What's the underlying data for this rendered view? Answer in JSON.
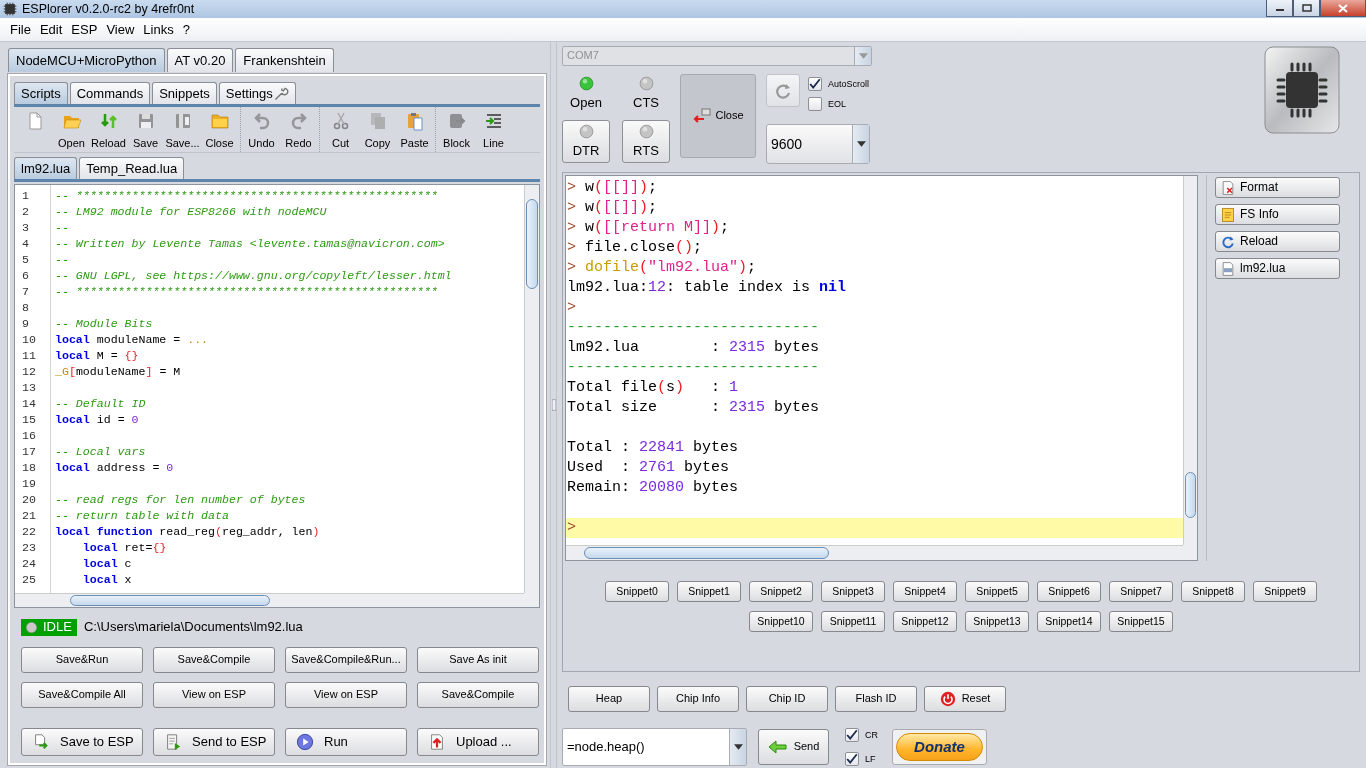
{
  "window": {
    "title": "ESPlorer v0.2.0-rc2 by 4refr0nt"
  },
  "menu": [
    "File",
    "Edit",
    "ESP",
    "View",
    "Links",
    "?"
  ],
  "device_tabs": [
    {
      "label": "NodeMCU+MicroPython",
      "selected": true
    },
    {
      "label": "AT v0.20",
      "selected": false
    },
    {
      "label": "Frankenshtein",
      "selected": false
    }
  ],
  "section_tabs": [
    {
      "label": "Scripts",
      "selected": true
    },
    {
      "label": "Commands",
      "selected": false
    },
    {
      "label": "Snippets",
      "selected": false
    },
    {
      "label": "Settings",
      "selected": false,
      "kind": "settings"
    }
  ],
  "toolbar": [
    [
      {
        "disabled": false
      },
      {
        "label": "Open",
        "disabled": false
      },
      {
        "label": "Reload",
        "disabled": false
      },
      {
        "label": "Save",
        "disabled": true
      },
      {
        "label": "Save...",
        "disabled": true
      },
      {
        "label": "Close",
        "disabled": false
      }
    ],
    [
      {
        "label": "Undo",
        "disabled": true
      },
      {
        "label": "Redo",
        "disabled": true
      }
    ],
    [
      {
        "label": "Cut",
        "disabled": true
      },
      {
        "label": "Copy",
        "disabled": true
      },
      {
        "label": "Paste",
        "disabled": false
      }
    ],
    [
      {
        "label": "Block",
        "disabled": true
      },
      {
        "label": "Line",
        "disabled": false
      }
    ]
  ],
  "file_tabs": [
    {
      "label": "lm92.lua",
      "selected": true
    },
    {
      "label": "Temp_Read.lua",
      "selected": false
    }
  ],
  "editor": {
    "lines": [
      {
        "number": "1",
        "segments": [
          {
            "kind": "comment",
            "text": "-- ****************************************************"
          }
        ]
      },
      {
        "number": "2",
        "segments": [
          {
            "kind": "comment",
            "text": "-- LM92 module for ESP8266 with nodeMCU"
          }
        ]
      },
      {
        "number": "3",
        "segments": [
          {
            "kind": "comment",
            "text": "--"
          }
        ]
      },
      {
        "number": "4",
        "segments": [
          {
            "kind": "comment",
            "text": "-- Written by Levente Tamas <levente.tamas@navicron.com>"
          }
        ]
      },
      {
        "number": "5",
        "segments": [
          {
            "kind": "comment",
            "text": "--"
          }
        ]
      },
      {
        "number": "6",
        "segments": [
          {
            "kind": "comment",
            "text": "-- GNU LGPL, see https://www.gnu.org/copyleft/lesser.html"
          }
        ]
      },
      {
        "number": "7",
        "segments": [
          {
            "kind": "comment",
            "text": "-- ****************************************************"
          }
        ]
      },
      {
        "number": "8"
      },
      {
        "number": "9",
        "segments": [
          {
            "kind": "comment",
            "text": "-- Module Bits"
          }
        ]
      },
      {
        "number": "10",
        "segments": [
          {
            "kind": "keyword",
            "text": "local"
          },
          {
            "kind": "plain",
            "text": " moduleName = "
          },
          {
            "kind": "global",
            "text": "..."
          }
        ]
      },
      {
        "number": "11",
        "segments": [
          {
            "kind": "keyword",
            "text": "local"
          },
          {
            "kind": "plain",
            "text": " M = "
          },
          {
            "kind": "bracket",
            "text": "{}"
          }
        ]
      },
      {
        "number": "12",
        "segments": [
          {
            "kind": "global",
            "text": "_G"
          },
          {
            "kind": "bracket",
            "text": "["
          },
          {
            "kind": "plain",
            "text": "moduleName"
          },
          {
            "kind": "bracket",
            "text": "]"
          },
          {
            "kind": "plain",
            "text": " = M"
          }
        ]
      },
      {
        "number": "13"
      },
      {
        "number": "14",
        "segments": [
          {
            "kind": "comment",
            "text": "-- Default ID"
          }
        ]
      },
      {
        "number": "15",
        "segments": [
          {
            "kind": "keyword",
            "text": "local"
          },
          {
            "kind": "plain",
            "text": " id = "
          },
          {
            "kind": "number",
            "text": "0"
          }
        ]
      },
      {
        "number": "16"
      },
      {
        "number": "17",
        "segments": [
          {
            "kind": "comment",
            "text": "-- Local vars"
          }
        ]
      },
      {
        "number": "18",
        "segments": [
          {
            "kind": "keyword",
            "text": "local"
          },
          {
            "kind": "plain",
            "text": " address = "
          },
          {
            "kind": "number",
            "text": "0"
          }
        ]
      },
      {
        "number": "19"
      },
      {
        "number": "20",
        "segments": [
          {
            "kind": "comment",
            "text": "-- read regs for len number of bytes"
          }
        ]
      },
      {
        "number": "21",
        "segments": [
          {
            "kind": "comment",
            "text": "-- return table with data"
          }
        ]
      },
      {
        "number": "22",
        "segments": [
          {
            "kind": "keyword",
            "text": "local function"
          },
          {
            "kind": "plain",
            "text": " read_reg"
          },
          {
            "kind": "bracket",
            "text": "("
          },
          {
            "kind": "plain",
            "text": "reg_addr, len"
          },
          {
            "kind": "bracket",
            "text": ")"
          }
        ],
        "children": [
          {
            "number": "23",
            "segments": [
              {
                "kind": "keyword",
                "text": "local"
              },
              {
                "kind": "plain",
                "text": " ret="
              },
              {
                "kind": "bracket",
                "text": "{}"
              }
            ]
          },
          {
            "number": "24",
            "segments": [
              {
                "kind": "keyword",
                "text": "local"
              },
              {
                "kind": "plain",
                "text": " c"
              }
            ]
          },
          {
            "number": "25",
            "segments": [
              {
                "kind": "keyword",
                "text": "local"
              },
              {
                "kind": "plain",
                "text": " x"
              }
            ]
          }
        ]
      }
    ]
  },
  "status": {
    "state": "IDLE",
    "path": "C:\\Users\\mariela\\Documents\\lm92.lua"
  },
  "script_buttons": [
    "Save&Run",
    "Save&Compile",
    "Save&Compile&Run...",
    "Save As init",
    "Save&Compile All",
    "View on ESP",
    "View on ESP",
    "Save&Compile"
  ],
  "action_buttons": [
    "Save to ESP",
    "Send to ESP",
    "Run",
    "Upload ..."
  ],
  "port": {
    "value": "COM7",
    "disabled": true
  },
  "signals": [
    {
      "label": "Open",
      "on": true,
      "kind": "indicator"
    },
    {
      "label": "DTR",
      "on": false,
      "kind": "toggle"
    },
    {
      "label": "CTS",
      "on": false,
      "kind": "indicator"
    },
    {
      "label": "RTS",
      "on": false,
      "kind": "toggle"
    }
  ],
  "connect_button": {
    "label": "Close"
  },
  "options": [
    {
      "label": "AutoScroll",
      "checked": true
    },
    {
      "label": "EOL",
      "checked": false
    }
  ],
  "baud": {
    "value": "9600"
  },
  "console": {
    "lines": [
      {
        "kind": "text",
        "highlighted": false,
        "segments": [
          {
            "kind": "prompt",
            "text": ">"
          },
          {
            "kind": "plain",
            "text": " w"
          },
          {
            "kind": "bracket",
            "text": "("
          },
          {
            "kind": "string",
            "text": "[[]]"
          },
          {
            "kind": "bracket",
            "text": ")"
          },
          {
            "kind": "plain",
            "text": ";"
          }
        ]
      },
      {
        "kind": "text",
        "highlighted": false,
        "segments": [
          {
            "kind": "prompt",
            "text": ">"
          },
          {
            "kind": "plain",
            "text": " w"
          },
          {
            "kind": "bracket",
            "text": "("
          },
          {
            "kind": "string",
            "text": "[[]]"
          },
          {
            "kind": "bracket",
            "text": ")"
          },
          {
            "kind": "plain",
            "text": ";"
          }
        ]
      },
      {
        "kind": "text",
        "highlighted": false,
        "segments": [
          {
            "kind": "prompt",
            "text": ">"
          },
          {
            "kind": "plain",
            "text": " w"
          },
          {
            "kind": "bracket",
            "text": "("
          },
          {
            "kind": "string",
            "text": "[[return M]]"
          },
          {
            "kind": "bracket",
            "text": ")"
          },
          {
            "kind": "plain",
            "text": ";"
          }
        ]
      },
      {
        "kind": "text",
        "highlighted": false,
        "segments": [
          {
            "kind": "prompt",
            "text": ">"
          },
          {
            "kind": "plain",
            "text": " file.close"
          },
          {
            "kind": "bracket",
            "text": "()"
          },
          {
            "kind": "plain",
            "text": ";"
          }
        ]
      },
      {
        "kind": "text",
        "highlighted": false,
        "segments": [
          {
            "kind": "prompt",
            "text": "> "
          },
          {
            "kind": "function",
            "text": "dofile"
          },
          {
            "kind": "bracket",
            "text": "("
          },
          {
            "kind": "string",
            "text": "\"lm92.lua\""
          },
          {
            "kind": "bracket",
            "text": ")"
          },
          {
            "kind": "plain",
            "text": ";"
          }
        ]
      },
      {
        "kind": "text",
        "highlighted": false,
        "segments": [
          {
            "kind": "plain",
            "text": "lm92.lua:"
          },
          {
            "kind": "number",
            "text": "12"
          },
          {
            "kind": "plain",
            "text": ": table index is "
          },
          {
            "kind": "keyword",
            "text": "nil"
          }
        ]
      },
      {
        "kind": "text",
        "highlighted": false,
        "segments": [
          {
            "kind": "prompt",
            "text": ">"
          }
        ]
      },
      {
        "kind": "text",
        "highlighted": false,
        "segments": [
          {
            "kind": "rule",
            "text": "----------------------------"
          }
        ]
      },
      {
        "kind": "text",
        "highlighted": false,
        "segments": [
          {
            "kind": "plain",
            "text": "lm92.lua        : "
          },
          {
            "kind": "number",
            "text": "2315"
          },
          {
            "kind": "plain",
            "text": " bytes"
          }
        ]
      },
      {
        "kind": "text",
        "highlighted": false,
        "segments": [
          {
            "kind": "rule",
            "text": "----------------------------"
          }
        ]
      },
      {
        "kind": "text",
        "highlighted": false,
        "segments": [
          {
            "kind": "plain",
            "text": "Total file"
          },
          {
            "kind": "bracket",
            "text": "("
          },
          {
            "kind": "plain",
            "text": "s"
          },
          {
            "kind": "bracket",
            "text": ")"
          },
          {
            "kind": "plain",
            "text": "   : "
          },
          {
            "kind": "number",
            "text": "1"
          }
        ]
      },
      {
        "kind": "text",
        "highlighted": false,
        "segments": [
          {
            "kind": "plain",
            "text": "Total size      : "
          },
          {
            "kind": "number",
            "text": "2315"
          },
          {
            "kind": "plain",
            "text": " bytes"
          }
        ]
      },
      {
        "kind": "blank",
        "highlighted": false
      },
      {
        "kind": "text",
        "highlighted": false,
        "segments": [
          {
            "kind": "plain",
            "text": "Total : "
          },
          {
            "kind": "number",
            "text": "22841"
          },
          {
            "kind": "plain",
            "text": " bytes"
          }
        ]
      },
      {
        "kind": "text",
        "highlighted": false,
        "segments": [
          {
            "kind": "plain",
            "text": "Used  : "
          },
          {
            "kind": "number",
            "text": "2761"
          },
          {
            "kind": "plain",
            "text": " bytes"
          }
        ]
      },
      {
        "kind": "text",
        "highlighted": false,
        "segments": [
          {
            "kind": "plain",
            "text": "Remain: "
          },
          {
            "kind": "number",
            "text": "20080"
          },
          {
            "kind": "plain",
            "text": " bytes"
          }
        ]
      },
      {
        "kind": "blank",
        "highlighted": false
      },
      {
        "kind": "text",
        "highlighted": true,
        "segments": [
          {
            "kind": "prompt",
            "text": ">"
          }
        ]
      }
    ]
  },
  "file_buttons": [
    "Format",
    "FS Info",
    "Reload",
    "lm92.lua"
  ],
  "snippets": [
    "Snippet0",
    "Snippet1",
    "Snippet2",
    "Snippet3",
    "Snippet4",
    "Snippet5",
    "Snippet6",
    "Snippet7",
    "Snippet8",
    "Snippet9",
    "Snippet10",
    "Snippet11",
    "Snippet12",
    "Snippet13",
    "Snippet14",
    "Snippet15"
  ],
  "commands": [
    "Heap",
    "Chip Info",
    "Chip ID",
    "Flash ID",
    "Reset"
  ],
  "command_input": {
    "value": "=node.heap()"
  },
  "send_button": "Send",
  "line_endings": [
    {
      "label": "CR",
      "checked": true
    },
    {
      "label": "LF",
      "checked": true
    }
  ],
  "donate_button": "Donate"
}
